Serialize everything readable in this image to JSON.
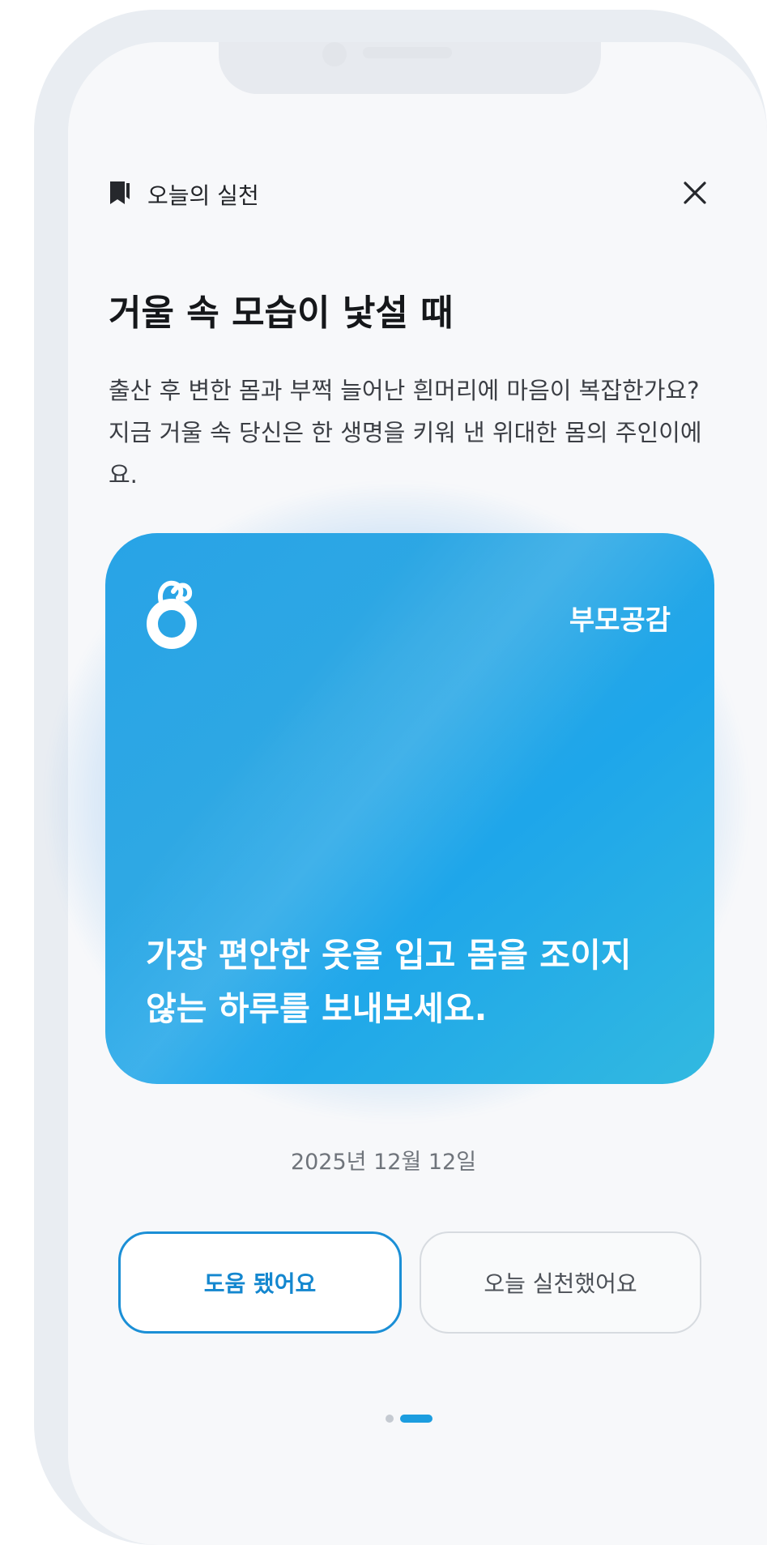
{
  "header": {
    "label": "오늘의 실천",
    "bookmark_icon": "bookmark-icon",
    "close_icon": "close-icon"
  },
  "title": "거울 속 모습이 낯설 때",
  "description": "출산 후 변한 몸과 부쩍 늘어난 흰머리에 마음이 복잡한가요? 지금 거울 속 당신은 한 생명을 키워 낸 위대한 몸의 주인이에요.",
  "card": {
    "brand": "부모공감",
    "logo_icon": "brand-logo-icon",
    "message": "가장 편안한 옷을 입고 몸을 조이지 않는 하루를 보내보세요.",
    "colors": {
      "gradient_start": "#28a3e6",
      "gradient_end": "#32b9e0"
    }
  },
  "date": "2025년 12월 12일",
  "buttons": {
    "helped": "도움 됐어요",
    "practiced": "오늘 실천했어요"
  },
  "pagination": {
    "total": 2,
    "active": 2
  },
  "colors": {
    "accent": "#1b8fd6",
    "background": "#f7f8fa"
  }
}
